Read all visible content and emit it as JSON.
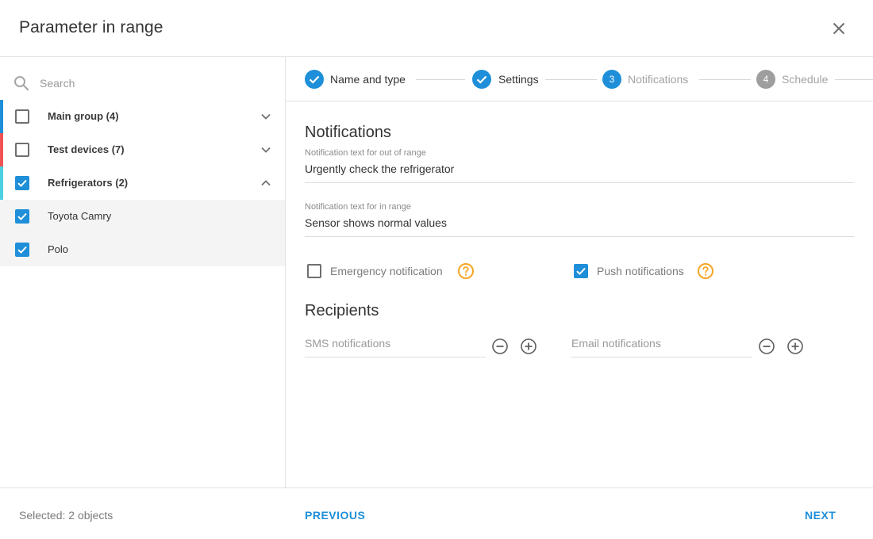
{
  "dialog": {
    "title": "Parameter in range"
  },
  "search": {
    "placeholder": "Search"
  },
  "tree": {
    "groups": [
      {
        "label": "Main group (4)",
        "color": "#1e8fd8",
        "checked": false
      },
      {
        "label": "Test devices (7)",
        "color": "#f05454",
        "checked": false
      },
      {
        "label": "Refrigerators (2)",
        "color": "#4dd0e1",
        "checked": true
      }
    ],
    "children": [
      {
        "label": "Toyota Camry",
        "checked": true
      },
      {
        "label": "Polo",
        "checked": true
      }
    ]
  },
  "stepper": {
    "steps": [
      {
        "label": "Name and type",
        "state": "done"
      },
      {
        "label": "Settings",
        "state": "done"
      },
      {
        "number": "3",
        "label": "Notifications",
        "state": "current"
      },
      {
        "number": "4",
        "label": "Schedule",
        "state": "pending"
      }
    ]
  },
  "notifications": {
    "title": "Notifications",
    "out_of_range": {
      "label": "Notification text for out of range",
      "value": "Urgently check the refrigerator"
    },
    "in_range": {
      "label": "Notification text for in range",
      "value": "Sensor shows normal values"
    },
    "emergency": {
      "label": "Emergency notification",
      "checked": false
    },
    "push": {
      "label": "Push notifications",
      "checked": true
    }
  },
  "recipients": {
    "title": "Recipients",
    "sms_placeholder": "SMS notifications",
    "email_placeholder": "Email notifications"
  },
  "footer": {
    "selected": "Selected: 2 objects",
    "previous": "PREVIOUS",
    "next": "NEXT"
  },
  "colors": {
    "accent": "#1e8fd8",
    "help": "#f5a623"
  }
}
